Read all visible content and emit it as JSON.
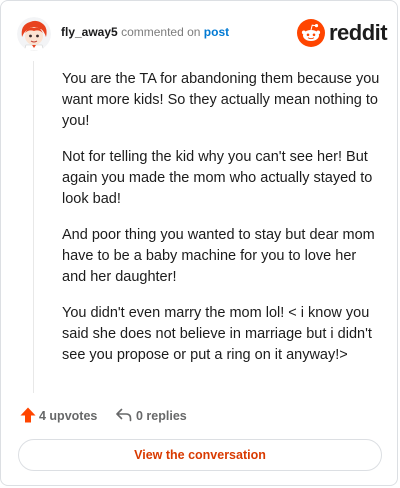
{
  "header": {
    "username": "fly_away5",
    "commented_on": "commented on",
    "post_link": "post",
    "brand": "reddit",
    "avatar_icon": "avatar-icon",
    "logo_icon": "reddit-logo-icon"
  },
  "comment": {
    "paragraphs": [
      "You are the TA for abandoning them because you want more kids! So they actually mean nothing to you!",
      "Not for telling the kid why you can't see her! But again you made the mom who actually stayed to look bad!",
      "And poor thing you wanted to stay but dear mom have to be a baby machine for you to love her and her daughter!",
      "You didn't even marry the mom lol! < i know you said she does not believe in marriage but i didn't see you propose or put a ring on it anyway!>"
    ]
  },
  "actions": {
    "upvotes": "4 upvotes",
    "replies": "0 replies",
    "upvote_icon": "upvote-arrow-icon",
    "reply_icon": "reply-arrow-icon"
  },
  "view_button": {
    "label": "View the conversation"
  },
  "colors": {
    "brand_orange": "#ff4500",
    "link_blue": "#0079d3",
    "button_text": "#d93a00"
  }
}
